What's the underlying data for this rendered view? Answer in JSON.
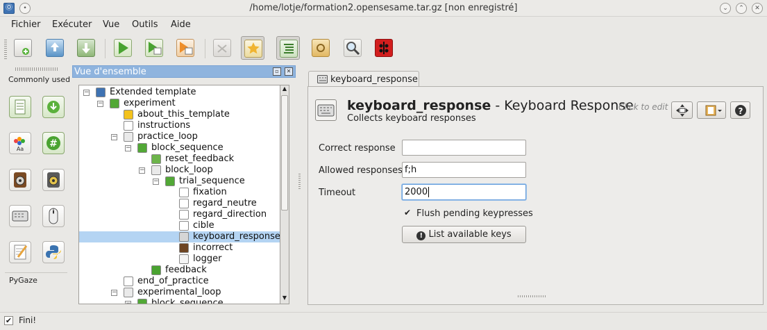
{
  "window": {
    "title": "/home/lotje/formation2.opensesame.tar.gz [non enregistré]"
  },
  "menubar": [
    "Fichier",
    "Exécuter",
    "Vue",
    "Outils",
    "Aide"
  ],
  "toolbar": {
    "icons": [
      "new-file-icon",
      "open-file-icon",
      "save-file-icon",
      "run-icon",
      "run-in-window-icon",
      "quick-run-icon",
      "kill-icon",
      "favorites-icon",
      "overview-icon",
      "pool-icon",
      "find-icon",
      "bug-icon"
    ]
  },
  "sidebar": {
    "section_title": "Commonly used",
    "items": [
      "sequence",
      "loop",
      "sketchpad",
      "feedback",
      "sampler",
      "synth",
      "keyboard_response",
      "mouse_response",
      "logger",
      "inline_script"
    ],
    "footer": "PyGaze"
  },
  "overview": {
    "title": "Vue d'ensemble",
    "tree": [
      {
        "label": "Extended template",
        "depth": 0,
        "icon": "experiment-icon",
        "expanded": true
      },
      {
        "label": "experiment",
        "depth": 1,
        "icon": "sequence-icon",
        "expanded": true
      },
      {
        "label": "about_this_template",
        "depth": 2,
        "icon": "inline-text-icon"
      },
      {
        "label": "instructions",
        "depth": 2,
        "icon": "sketchpad-icon"
      },
      {
        "label": "practice_loop",
        "depth": 2,
        "icon": "loop-icon",
        "expanded": true
      },
      {
        "label": "block_sequence",
        "depth": 3,
        "icon": "sequence-icon",
        "expanded": true
      },
      {
        "label": "reset_feedback",
        "depth": 4,
        "icon": "reset-icon"
      },
      {
        "label": "block_loop",
        "depth": 4,
        "icon": "loop-icon",
        "expanded": true
      },
      {
        "label": "trial_sequence",
        "depth": 5,
        "icon": "sequence-icon",
        "expanded": true
      },
      {
        "label": "fixation",
        "depth": 6,
        "icon": "sketchpad-icon"
      },
      {
        "label": "regard_neutre",
        "depth": 6,
        "icon": "sketchpad-icon"
      },
      {
        "label": "regard_direction",
        "depth": 6,
        "icon": "sketchpad-icon"
      },
      {
        "label": "cible",
        "depth": 6,
        "icon": "sketchpad-icon"
      },
      {
        "label": "keyboard_response",
        "depth": 6,
        "icon": "keyboard-icon",
        "selected": true
      },
      {
        "label": "incorrect",
        "depth": 6,
        "icon": "sampler-icon"
      },
      {
        "label": "logger",
        "depth": 6,
        "icon": "logger-icon"
      },
      {
        "label": "feedback",
        "depth": 4,
        "icon": "feedback-icon"
      },
      {
        "label": "end_of_practice",
        "depth": 2,
        "icon": "sketchpad-icon"
      },
      {
        "label": "experimental_loop",
        "depth": 2,
        "icon": "loop-icon",
        "expanded": true
      },
      {
        "label": "block_sequence",
        "depth": 3,
        "icon": "sequence-icon",
        "expanded": true
      }
    ]
  },
  "item": {
    "tab_label": "keyboard_response",
    "name": "keyboard_response",
    "separator": " - ",
    "type": "Keyboard Response",
    "click_to_edit": "Click to edit",
    "description": "Collects keyboard responses",
    "fields": {
      "correct_response": {
        "label": "Correct response",
        "value": ""
      },
      "allowed_responses": {
        "label": "Allowed responses",
        "value": "f;h"
      },
      "timeout": {
        "label": "Timeout",
        "value": "2000"
      }
    },
    "flush": {
      "label": "Flush pending keypresses",
      "checked": true
    },
    "list_keys_button": "List available keys"
  },
  "status": {
    "text": "Fini!",
    "checked": true
  }
}
